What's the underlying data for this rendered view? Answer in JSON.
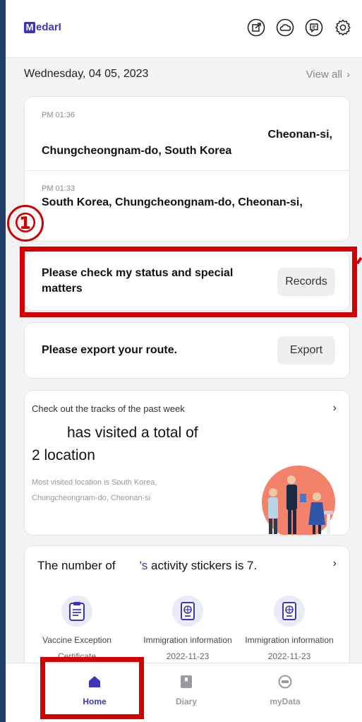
{
  "header": {
    "logo_first": "M",
    "logo_rest": "edarI",
    "icons": [
      "share-icon",
      "cloud-icon",
      "message-icon",
      "gear-icon"
    ]
  },
  "date_row": {
    "date": "Wednesday, 04 05, 2023",
    "view_all": "View all"
  },
  "locations": [
    {
      "time": "PM 01:36",
      "line1": "Cheonan-si,",
      "line2": "Chungcheongnam-do, South Korea"
    },
    {
      "time": "PM 01:33",
      "line1": "South Korea, Chungcheongnam-do, Cheonan-si,"
    }
  ],
  "annotation": {
    "marker": "①"
  },
  "records_card": {
    "text_line1": "Please check my status and special",
    "text_line2": "matters",
    "button": "Records"
  },
  "export_card": {
    "text": "Please export your route.",
    "button": "Export"
  },
  "tracks": {
    "header": "Check out the tracks of the past week",
    "line1": "has visited a total of",
    "line2": "2 location",
    "small1": "Most visited location is South Korea,",
    "small2": "Chungcheongnam-do, Cheonan-si"
  },
  "stickers": {
    "title_prefix": "The number of",
    "title_possessive": "'s",
    "title_suffix": " activity stickers is 7.",
    "items": [
      {
        "label": "Vaccine Exception",
        "sub": "Certificate"
      },
      {
        "label": "Immigration information",
        "sub": "2022-11-23"
      },
      {
        "label": "Immigration information",
        "sub": "2022-11-23"
      }
    ]
  },
  "nav": {
    "items": [
      {
        "label": "Home",
        "active": true
      },
      {
        "label": "Diary",
        "active": false
      },
      {
        "label": "myData",
        "active": false
      }
    ],
    "active_color": "#3d35b8",
    "inactive_color": "#9a9aa0"
  },
  "colors": {
    "brand": "#3d35b8",
    "highlight": "#d40000",
    "background": "#1f3f66"
  }
}
